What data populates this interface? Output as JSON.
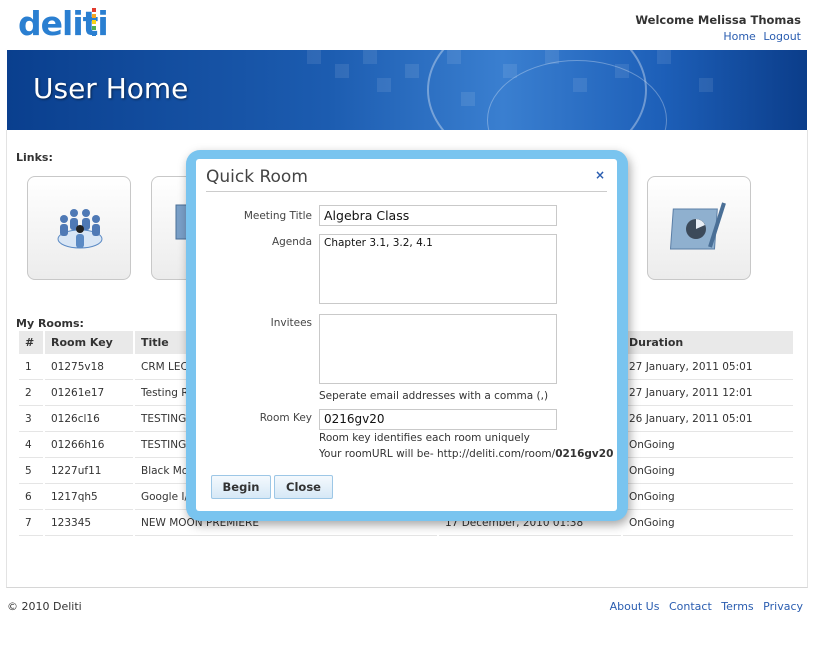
{
  "header": {
    "logo_text": "deliti",
    "logo_colors": [
      "#e23b2e",
      "#f5a623",
      "#f8d416",
      "#4caf50",
      "#2a7fd1"
    ],
    "welcome": "Welcome Melissa Thomas",
    "links": [
      "Home",
      "Logout"
    ]
  },
  "banner": {
    "title": "User Home"
  },
  "links_section": {
    "label": "Links:",
    "tiles": [
      "meeting-people-icon",
      "presentation-icon",
      "pie-chart-pen-icon"
    ]
  },
  "rooms": {
    "label": "My Rooms:",
    "columns": [
      "#",
      "Room Key",
      "Title",
      "Duration"
    ],
    "rows": [
      {
        "num": "1",
        "key": "01275v18",
        "title": "CRM LECT",
        "date": "",
        "duration": "27 January, 2011 05:01"
      },
      {
        "num": "2",
        "key": "01261e17",
        "title": "Testing R",
        "date": "",
        "duration": "27 January, 2011 12:01"
      },
      {
        "num": "3",
        "key": "0126cl16",
        "title": "TESTING",
        "date": "",
        "duration": "26 January, 2011 05:01"
      },
      {
        "num": "4",
        "key": "01266h16",
        "title": "TESTING",
        "date": "",
        "duration": "OnGoing"
      },
      {
        "num": "5",
        "key": "1227uf11",
        "title": "Black Moo",
        "date": "",
        "duration": "OnGoing"
      },
      {
        "num": "6",
        "key": "1217qh5",
        "title": "Google I/",
        "date": "",
        "duration": "OnGoing"
      },
      {
        "num": "7",
        "key": "123345",
        "title": "NEW MOON PREMIERE",
        "date": "17 December, 2010 01:38",
        "duration": "OnGoing"
      }
    ]
  },
  "footer": {
    "copyright": "© 2010 Deliti",
    "links": [
      "About Us",
      "Contact",
      "Terms",
      "Privacy"
    ]
  },
  "modal": {
    "title": "Quick Room",
    "close": "×",
    "meeting_title_label": "Meeting Title",
    "meeting_title_value": "Algebra Class",
    "agenda_label": "Agenda",
    "agenda_value": "Chapter 3.1, 3.2, 4.1",
    "invitees_label": "Invitees",
    "invitees_value": "",
    "invitees_hint": "Seperate email addresses with a comma (,)",
    "room_key_label": "Room Key",
    "room_key_value": "0216gv20",
    "room_key_hint": "Room key identifies each room uniquely",
    "url_prefix": "Your roomURL will be- http://deliti.com/room/",
    "url_key": "0216gv20",
    "begin_label": "Begin",
    "close_label": "Close"
  }
}
